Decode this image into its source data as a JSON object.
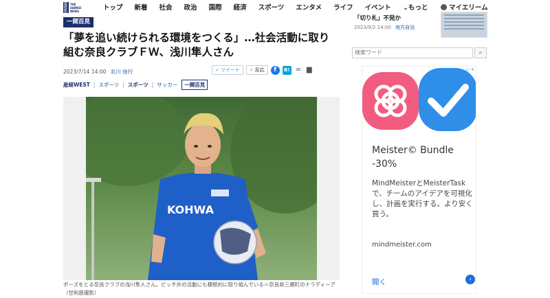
{
  "brand": {
    "logo_text": "THE SANKEI NEWS",
    "mark_text": "産経新聞"
  },
  "nav": {
    "items": [
      "トップ",
      "新着",
      "社会",
      "政治",
      "国際",
      "経済",
      "スポーツ",
      "エンタメ",
      "ライフ",
      "イベント"
    ],
    "more": "⌄もっと",
    "mypage": "マイエリーム"
  },
  "article": {
    "tag": "一関百見",
    "headline": "「夢を追い続けられる環境をつくる」…社会活動に取り組む奈良クラブＦＷ、浅川隼人さん",
    "date": "2023/7/14 14:00",
    "author": "北川 信行",
    "categories": [
      "産経WEST",
      "スポーツ",
      "スポーツ",
      "サッカー"
    ],
    "category_box": "一関百見",
    "caption": "ポーズをとる奈良クラブの浅川隼人さん。ピッチ外の活動にも積極的に取り組んでいる＝奈良県三郷町のナラディーア（甘利慈撮影）"
  },
  "share": {
    "tweet": "ツイート",
    "reaction": "反応"
  },
  "sidebar": {
    "top_snippet": "「切り札」不発か",
    "top_date": "2023/9/2 14:00",
    "top_section": "地方自治",
    "search_placeholder": "検索ワード"
  },
  "ad": {
    "badge": "▷ ✕",
    "title": "Meister© Bundle",
    "discount": "-30%",
    "body": "MindMeisterとMeisterTaskで、チームのアイデアを可視化し、計画を実行する。より安く買う。",
    "url": "mindmeister.com",
    "cta": "開く",
    "colors": {
      "pink": "#f25c7e",
      "blue": "#2f8ee8"
    }
  }
}
